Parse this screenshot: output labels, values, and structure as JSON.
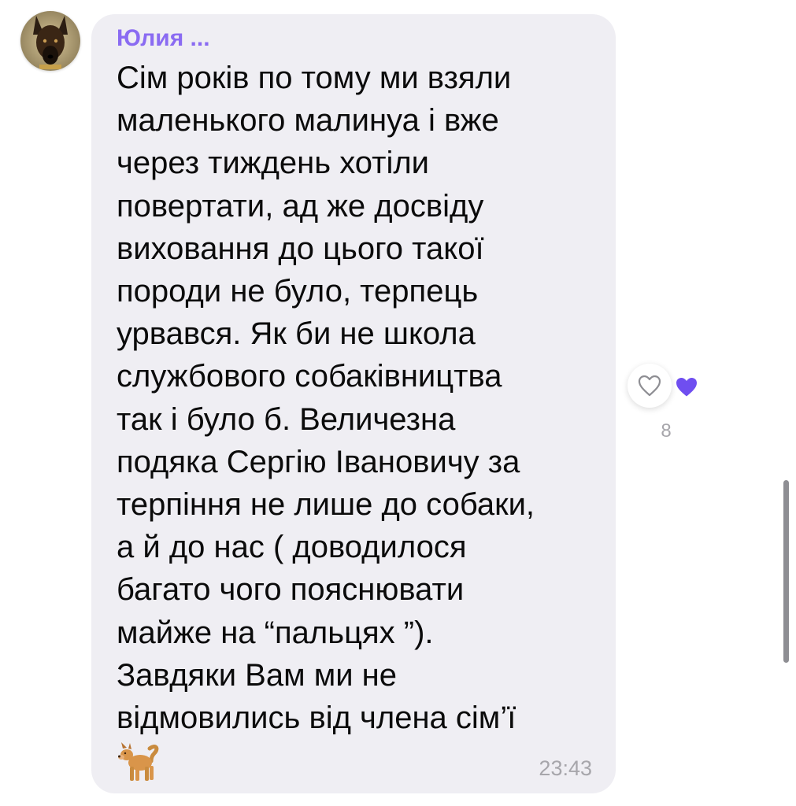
{
  "message": {
    "sender": "Юлия ...",
    "text": "Сім років по тому ми взяли\nмаленького малинуа і вже\nчерез тиждень хотіли\nповертати, ад же досвіду\nвиховання до цього такої\nпороди не було, терпець\nурвався. Як би не школа\nслужбового собаківництва\nтак і було б.  Величезна\nподяка Сергію Івановичу за\nтерпіння не лише до собаки,\nа й до нас ( доводилося\nбагато чого пояснювати\nмайже на “пальцях ”).\nЗавдяки Вам ми не\nвідмовились від члена сім’ї",
    "emoji": "dog-emoji",
    "time": "23:43"
  },
  "reactions": {
    "heart_button_icon": "heart-outline-icon",
    "active_reaction_icon": "purple-heart-icon",
    "active_color": "#6f4ef0",
    "count": "8"
  },
  "colors": {
    "sender": "#8a6bf2",
    "bubble": "#efeef3",
    "time": "#a7a6ab"
  }
}
